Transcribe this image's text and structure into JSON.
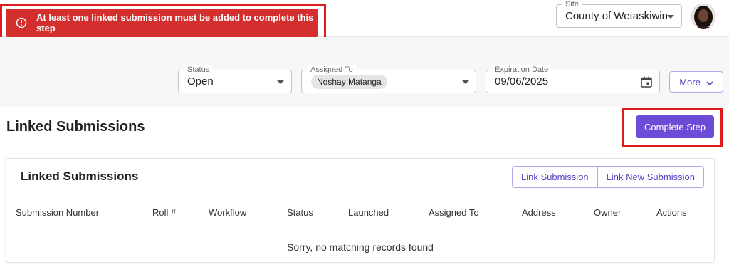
{
  "alert": {
    "message": "At least one linked submission must be added to complete this step",
    "icon": "alert-circle-icon",
    "color": "#d32f2f"
  },
  "site": {
    "legend": "Site",
    "value": "County of Wetaskiwin"
  },
  "user": {
    "avatar_icon": "user-avatar"
  },
  "filters": {
    "status": {
      "legend": "Status",
      "value": "Open"
    },
    "assigned_to": {
      "legend": "Assigned To",
      "value": "Noshay Matanga"
    },
    "expiration_date": {
      "legend": "Expiration Date",
      "value": "09/06/2025",
      "icon": "calendar-icon"
    },
    "more_label": "More"
  },
  "section": {
    "title": "Linked Submissions",
    "complete_step_label": "Complete Step"
  },
  "card": {
    "title": "Linked Submissions",
    "link_submission_label": "Link Submission",
    "link_new_submission_label": "Link New Submission",
    "columns": [
      "Submission Number",
      "Roll #",
      "Workflow",
      "Status",
      "Launched",
      "Assigned To",
      "Address",
      "Owner",
      "Actions"
    ],
    "empty_message": "Sorry, no matching records found"
  },
  "colors": {
    "accent": "#6c4cd6",
    "highlight": "#e01b1b"
  }
}
